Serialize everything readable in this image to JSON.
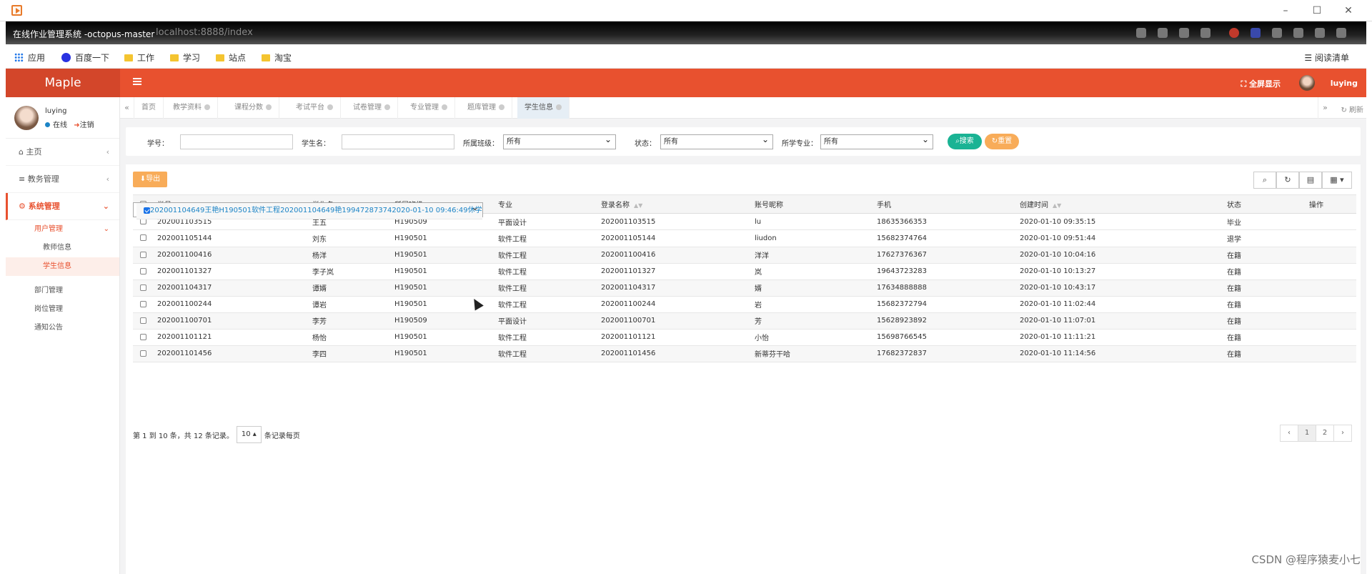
{
  "browser": {
    "window_title": "在线作业管理系统 -octopus-master",
    "url": "localhost:8888/index",
    "bookmarks": [
      "应用",
      "百度一下",
      "工作",
      "学习",
      "站点",
      "淘宝"
    ],
    "reading_list": "阅读清单"
  },
  "app": {
    "logo": "Maple",
    "fullscreen": "全屏显示",
    "username": "luying"
  },
  "user": {
    "name": "luying",
    "status": "在线",
    "logout": "注销"
  },
  "sidebar": {
    "home": "主页",
    "academic": "教务管理",
    "system": "系统管理",
    "user_mgmt": "用户管理",
    "teacher_info": "教师信息",
    "student_info": "学生信息",
    "dept": "部门管理",
    "post": "岗位管理",
    "notice": "通知公告"
  },
  "tabs": [
    "首页",
    "教学资料",
    "课程分数",
    "考试平台",
    "试卷管理",
    "专业管理",
    "题库管理",
    "学生信息"
  ],
  "tabs_refresh": "刷新",
  "search": {
    "student_no": "学号：",
    "student_name": "学生名：",
    "class": "所属班级：",
    "class_value": "所有",
    "status": "状态：",
    "status_value": "所有",
    "major": "所学专业：",
    "major_value": "所有",
    "search_btn": "搜索",
    "reset_btn": "重置"
  },
  "toolbar": {
    "export": "导出"
  },
  "table": {
    "headers": [
      "学号",
      "学生名",
      "所属班级",
      "专业",
      "登录名称",
      "账号昵称",
      "手机",
      "创建时间",
      "状态",
      "操作"
    ],
    "rows": [
      [
        "202001103515",
        "王五",
        "H190509",
        "平面设计",
        "202001103515",
        "lu",
        "18635366353",
        "2020-01-10 09:35:15",
        "毕业"
      ],
      [
        "202001104649",
        "王艳",
        "H190501",
        "软件工程",
        "202001104649",
        "艳",
        "19947287374",
        "2020-01-10 09:46:49",
        "休学"
      ],
      [
        "202001105144",
        "刘东",
        "H190501",
        "软件工程",
        "202001105144",
        "liudon",
        "15682374764",
        "2020-01-10 09:51:44",
        "退学"
      ],
      [
        "202001100416",
        "杨洋",
        "H190501",
        "软件工程",
        "202001100416",
        "洋洋",
        "17627376367",
        "2020-01-10 10:04:16",
        "在籍"
      ],
      [
        "202001101327",
        "李子岚",
        "H190501",
        "软件工程",
        "202001101327",
        "岚",
        "19643723283",
        "2020-01-10 10:13:27",
        "在籍"
      ],
      [
        "202001104317",
        "谭婿",
        "H190501",
        "软件工程",
        "202001104317",
        "婿",
        "17634888888",
        "2020-01-10 10:43:17",
        "在籍"
      ],
      [
        "202001100244",
        "谭岩",
        "H190501",
        "软件工程",
        "202001100244",
        "岩",
        "15682372794",
        "2020-01-10 11:02:44",
        "在籍"
      ],
      [
        "202001100701",
        "李芳",
        "H190509",
        "平面设计",
        "202001100701",
        "芳",
        "15628923892",
        "2020-01-10 11:07:01",
        "在籍"
      ],
      [
        "202001101121",
        "杨怡",
        "H190501",
        "软件工程",
        "202001101121",
        "小怡",
        "15698766545",
        "2020-01-10 11:11:21",
        "在籍"
      ],
      [
        "202001101456",
        "李四",
        "H190501",
        "软件工程",
        "202001101456",
        "新蒂芬干哈",
        "17682372837",
        "2020-01-10 11:14:56",
        "在籍"
      ]
    ],
    "checked_row": 1
  },
  "pagination": {
    "info": "第 1 到 10 条，共 12 条记录。",
    "page_size": "10",
    "per_page": "条记录每页",
    "pages": [
      "‹",
      "1",
      "2",
      "›"
    ]
  },
  "watermark": "CSDN @程序猿麦小七"
}
